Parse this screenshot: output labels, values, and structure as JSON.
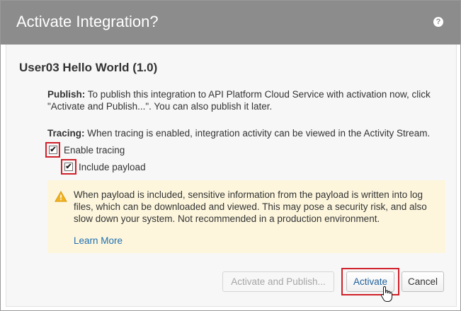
{
  "dialog": {
    "title": "Activate Integration?",
    "help_icon_glyph": "?",
    "heading": "User03 Hello World (1.0)"
  },
  "publish": {
    "label": "Publish:",
    "text": " To publish this integration to API Platform Cloud Service with activation now, click \"Activate and Publish...\". You can also publish it later."
  },
  "tracing": {
    "label": "Tracing:",
    "text": " When tracing is enabled, integration activity can be viewed in the Activity Stream.",
    "enable_label": "Enable tracing",
    "enable_checked": true,
    "payload_label": "Include payload",
    "payload_checked": true
  },
  "warning": {
    "icon": "warning-triangle-icon",
    "text": "When payload is included, sensitive information from the payload is written into log files, which can be downloaded and viewed. This may pose a security risk, and also slow down your system. Not recommended in a production environment.",
    "link": "Learn More"
  },
  "buttons": {
    "activate_publish": "Activate and Publish...",
    "activate": "Activate",
    "cancel": "Cancel"
  },
  "colors": {
    "titlebar": "#8c8c8c",
    "highlight": "#d0202a",
    "warning_bg": "#fdf6dd",
    "link": "#1f6fb0"
  }
}
